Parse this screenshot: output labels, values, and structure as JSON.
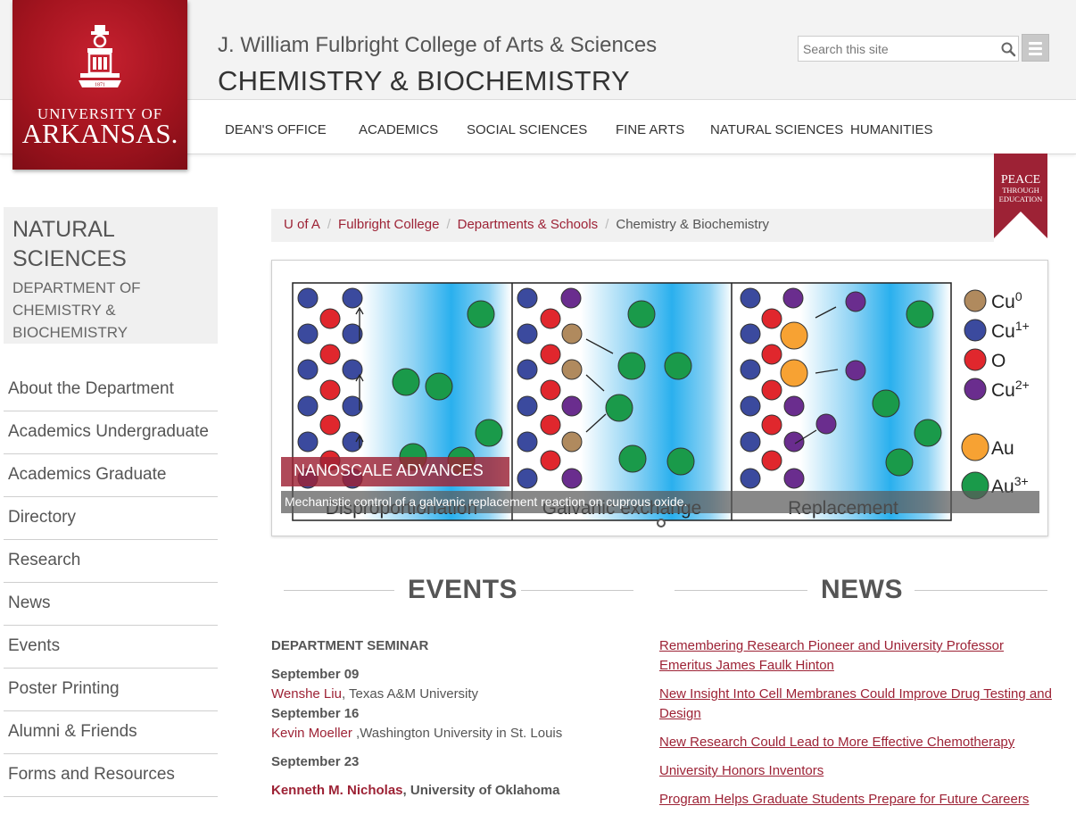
{
  "brand": {
    "logo_year": "1871",
    "logo_line1": "UNIVERSITY OF",
    "logo_line2": "ARKANSAS.",
    "color_primary": "#9d2235"
  },
  "header": {
    "college_title": "J. William Fulbright College of Arts & Sciences",
    "dept_title": "CHEMISTRY & BIOCHEMISTRY",
    "search_placeholder": "Search this site",
    "search_icon": "search-icon",
    "menu_icon": "hamburger-icon"
  },
  "nav": {
    "items": [
      {
        "label": "DEAN'S OFFICE"
      },
      {
        "label": "ACADEMICS"
      },
      {
        "label": "SOCIAL SCIENCES"
      },
      {
        "label": "FINE ARTS"
      },
      {
        "label": "NATURAL SCIENCES"
      },
      {
        "label": "HUMANITIES"
      }
    ]
  },
  "badge": {
    "line1": "PEACE",
    "line2": "THROUGH",
    "line3": "EDUCATION"
  },
  "sidebar": {
    "heading": "NATURAL SCIENCES",
    "subheading": "DEPARTMENT OF CHEMISTRY & BIOCHEMISTRY",
    "items": [
      {
        "label": "About the Department"
      },
      {
        "label": "Academics Undergraduate"
      },
      {
        "label": "Academics Graduate"
      },
      {
        "label": "Directory"
      },
      {
        "label": "Research"
      },
      {
        "label": "News"
      },
      {
        "label": "Events"
      },
      {
        "label": "Poster Printing"
      },
      {
        "label": "Alumni & Friends"
      },
      {
        "label": "Forms and Resources"
      }
    ]
  },
  "breadcrumb": {
    "items": [
      {
        "label": "U of A"
      },
      {
        "label": "Fulbright College"
      },
      {
        "label": "Departments & Schools"
      }
    ],
    "current": "Chemistry & Biochemistry"
  },
  "slider": {
    "panel_titles": [
      "Disproportionation",
      "Galvanic exchange",
      "Replacement"
    ],
    "legend": [
      {
        "label": "Cu",
        "sup": "0",
        "color": "#b08a5e"
      },
      {
        "label": "Cu",
        "sup": "1+",
        "color": "#3b4a9e"
      },
      {
        "label": "O",
        "sup": "",
        "color": "#e0272d"
      },
      {
        "label": "Cu",
        "sup": "2+",
        "color": "#6a2d8e"
      },
      {
        "label": "Au",
        "sup": "",
        "color": "#f7a233"
      },
      {
        "label": "Au",
        "sup": "3+",
        "color": "#1a9a4a"
      }
    ],
    "label": "NANOSCALE ADVANCES",
    "caption": "Mechanistic control of a galvanic replacement reaction on cuprous oxide."
  },
  "events": {
    "title": "EVENTS",
    "category": "DEPARTMENT SEMINAR",
    "entries": [
      {
        "date": "September 09",
        "name": "Wenshe Liu",
        "affil": ", Texas A&M University"
      },
      {
        "date": "September 16",
        "name": "Kevin Moeller",
        "affil": " ,Washington University in St. Louis"
      },
      {
        "date": "September 23",
        "name": "Kenneth M. Nicholas",
        "affil": ", University of Oklahoma"
      }
    ]
  },
  "news": {
    "title": "NEWS",
    "items": [
      {
        "label": "Remembering Research Pioneer and University Professor Emeritus James Faulk Hinton"
      },
      {
        "label": "New Insight Into Cell Membranes Could Improve Drug Testing and Design"
      },
      {
        "label": "New Research Could Lead to More Effective Chemotherapy"
      },
      {
        "label": "University Honors Inventors"
      },
      {
        "label": "Program Helps Graduate Students Prepare for Future Careers"
      }
    ]
  }
}
